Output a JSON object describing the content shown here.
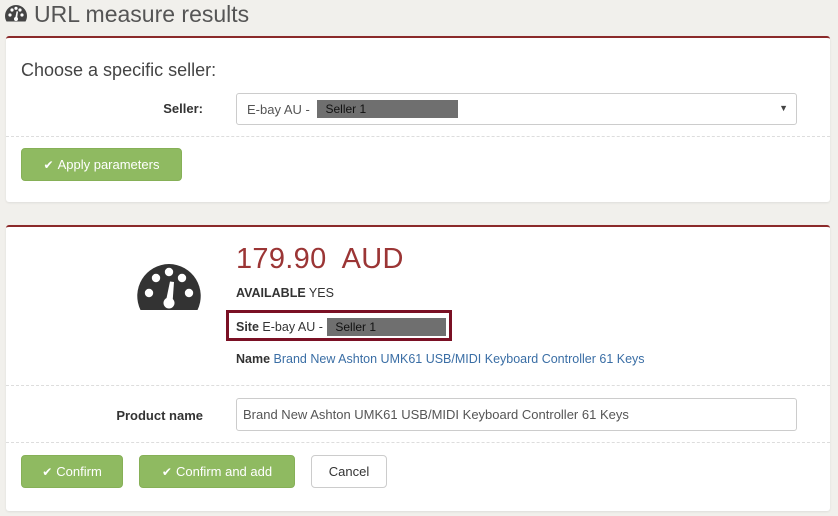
{
  "page": {
    "title": "URL measure results"
  },
  "seller_panel": {
    "heading": "Choose a specific seller:",
    "seller_label": "Seller:",
    "seller_select": {
      "prefix": "E-bay AU - ",
      "masked_value": "Seller 1"
    },
    "apply_button": "Apply parameters"
  },
  "result_panel": {
    "price": "179.90",
    "currency": "AUD",
    "available_label": "AVAILABLE",
    "available_value": "YES",
    "site_label": "Site",
    "site_prefix": "E-bay AU - ",
    "site_masked": "Seller 1",
    "name_label": "Name",
    "name_value": "Brand New Ashton UMK61 USB/MIDI Keyboard Controller 61 Keys",
    "product_name_label": "Product name",
    "product_name_value": "Brand New Ashton UMK61 USB/MIDI Keyboard Controller 61 Keys",
    "confirm_button": "Confirm",
    "confirm_add_button": "Confirm and add",
    "cancel_button": "Cancel"
  },
  "colors": {
    "accent": "#8b2a2a",
    "price": "#9b3535",
    "button_green": "#8fba61",
    "link": "#3a6ea5",
    "highlight": "#7a1024"
  }
}
